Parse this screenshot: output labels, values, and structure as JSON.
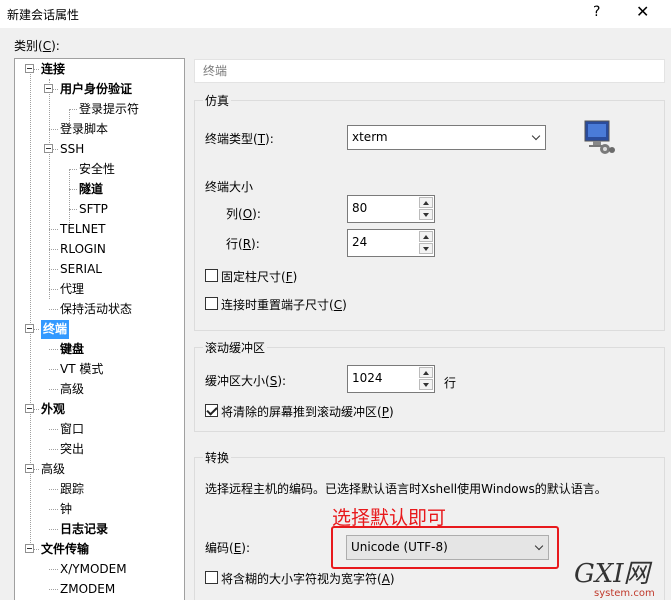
{
  "window": {
    "title": "新建会话属性",
    "help": "?",
    "close": "✕"
  },
  "category": {
    "label_pre": "类别(",
    "label_key": "C",
    "label_post": "):"
  },
  "tree": [
    {
      "label": "连接",
      "bold": true
    },
    {
      "label": "用户身份验证",
      "bold": true
    },
    {
      "label": "登录提示符"
    },
    {
      "label": "登录脚本"
    },
    {
      "label": "SSH"
    },
    {
      "label": "安全性"
    },
    {
      "label": "隧道",
      "bold": true
    },
    {
      "label": "SFTP"
    },
    {
      "label": "TELNET"
    },
    {
      "label": "RLOGIN"
    },
    {
      "label": "SERIAL"
    },
    {
      "label": "代理"
    },
    {
      "label": "保持活动状态"
    },
    {
      "label": "终端",
      "selected": true
    },
    {
      "label": "键盘",
      "bold": true
    },
    {
      "label": "VT 模式"
    },
    {
      "label": "高级"
    },
    {
      "label": "外观",
      "bold": true
    },
    {
      "label": "窗口"
    },
    {
      "label": "突出"
    },
    {
      "label": "高级"
    },
    {
      "label": "跟踪"
    },
    {
      "label": "钟"
    },
    {
      "label": "日志记录",
      "bold": true
    },
    {
      "label": "文件传输",
      "bold": true
    },
    {
      "label": "X/YMODEM"
    },
    {
      "label": "ZMODEM"
    }
  ],
  "panel": {
    "header": "终端",
    "emulation": {
      "title": "仿真",
      "terminal_type_pre": "终端类型(",
      "terminal_type_key": "T",
      "terminal_type_post": "):",
      "terminal_type_value": "xterm",
      "size_title": "终端大小",
      "cols_pre": "列(",
      "cols_key": "O",
      "cols_post": "):",
      "cols_value": "80",
      "rows_pre": "行(",
      "rows_key": "R",
      "rows_post": "):",
      "rows_value": "24",
      "fixed_pre": "固定柱尺寸(",
      "fixed_key": "F",
      "fixed_post": ")",
      "resize_pre": "连接时重置端子尺寸(",
      "resize_key": "C",
      "resize_post": ")"
    },
    "scroll": {
      "title": "滚动缓冲区",
      "size_pre": "缓冲区大小(",
      "size_key": "S",
      "size_post": "):",
      "size_value": "1024",
      "unit": "行",
      "push_pre": "将清除的屏幕推到滚动缓冲区(",
      "push_key": "P",
      "push_post": ")"
    },
    "translate": {
      "title": "转换",
      "desc": "选择远程主机的编码。已选择默认语言时Xshell使用Windows的默认语言。",
      "enc_pre": "编码(",
      "enc_key": "E",
      "enc_post": "):",
      "enc_value": "Unicode (UTF-8)",
      "wide_pre": "将含糊的大小字符视为宽字符(",
      "wide_key": "A",
      "wide_post": ")"
    }
  },
  "annotation": "选择默认即可",
  "watermark": {
    "brand": "GXI网",
    "domain": "system.com"
  },
  "colors": {
    "accent": "#3399ff",
    "annotation": "#e8191c"
  }
}
